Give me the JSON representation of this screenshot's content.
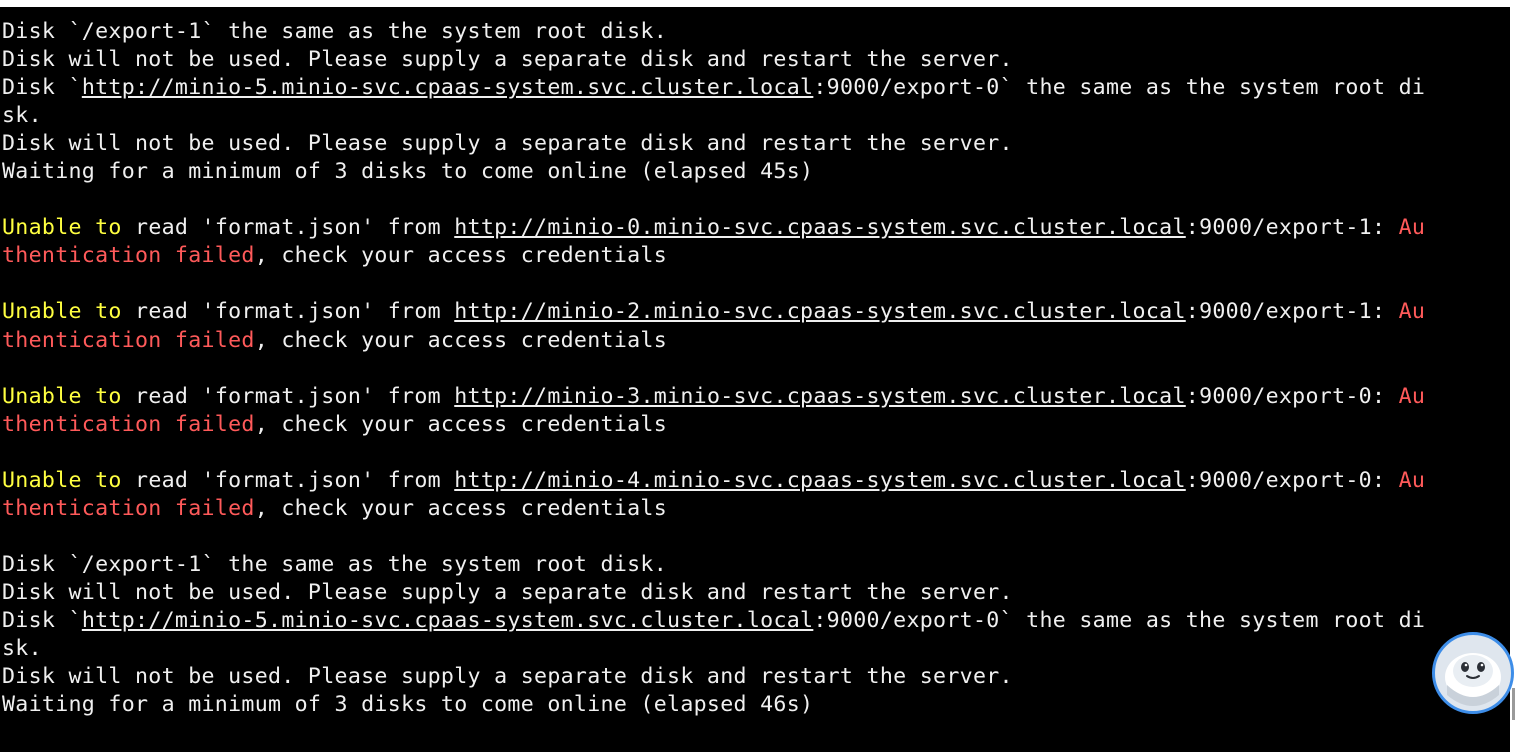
{
  "terminal": {
    "lines": [
      [
        {
          "t": "Disk `/export-1` the same as the system root disk.",
          "c": "w"
        }
      ],
      [
        {
          "t": "Disk will not be used. Please supply a separate disk and restart the server.",
          "c": "w"
        }
      ],
      [
        {
          "t": "Disk `",
          "c": "w"
        },
        {
          "t": "http://minio-5.minio-svc.cpaas-system.svc.cluster.local",
          "c": "w",
          "u": true
        },
        {
          "t": ":9000/export-0` the same as the system root di",
          "c": "w"
        }
      ],
      [
        {
          "t": "sk.",
          "c": "w"
        }
      ],
      [
        {
          "t": "Disk will not be used. Please supply a separate disk and restart the server.",
          "c": "w"
        }
      ],
      [
        {
          "t": "Waiting for a minimum of 3 disks to come online (elapsed 45s)",
          "c": "w"
        }
      ],
      [
        {
          "t": "",
          "c": "w"
        }
      ],
      [
        {
          "t": "Unable to",
          "c": "y"
        },
        {
          "t": " read 'format.json' from ",
          "c": "w"
        },
        {
          "t": "http://minio-0.minio-svc.cpaas-system.svc.cluster.local",
          "c": "w",
          "u": true
        },
        {
          "t": ":9000/export-1: ",
          "c": "w"
        },
        {
          "t": "Au",
          "c": "r"
        }
      ],
      [
        {
          "t": "thentication failed",
          "c": "r"
        },
        {
          "t": ", check your access credentials",
          "c": "w"
        }
      ],
      [
        {
          "t": "",
          "c": "w"
        }
      ],
      [
        {
          "t": "Unable to",
          "c": "y"
        },
        {
          "t": " read 'format.json' from ",
          "c": "w"
        },
        {
          "t": "http://minio-2.minio-svc.cpaas-system.svc.cluster.local",
          "c": "w",
          "u": true
        },
        {
          "t": ":9000/export-1: ",
          "c": "w"
        },
        {
          "t": "Au",
          "c": "r"
        }
      ],
      [
        {
          "t": "thentication failed",
          "c": "r"
        },
        {
          "t": ", check your access credentials",
          "c": "w"
        }
      ],
      [
        {
          "t": "",
          "c": "w"
        }
      ],
      [
        {
          "t": "Unable to",
          "c": "y"
        },
        {
          "t": " read 'format.json' from ",
          "c": "w"
        },
        {
          "t": "http://minio-3.minio-svc.cpaas-system.svc.cluster.local",
          "c": "w",
          "u": true
        },
        {
          "t": ":9000/export-0: ",
          "c": "w"
        },
        {
          "t": "Au",
          "c": "r"
        }
      ],
      [
        {
          "t": "thentication failed",
          "c": "r"
        },
        {
          "t": ", check your access credentials",
          "c": "w"
        }
      ],
      [
        {
          "t": "",
          "c": "w"
        }
      ],
      [
        {
          "t": "Unable to",
          "c": "y"
        },
        {
          "t": " read 'format.json' from ",
          "c": "w"
        },
        {
          "t": "http://minio-4.minio-svc.cpaas-system.svc.cluster.local",
          "c": "w",
          "u": true
        },
        {
          "t": ":9000/export-0: ",
          "c": "w"
        },
        {
          "t": "Au",
          "c": "r"
        }
      ],
      [
        {
          "t": "thentication failed",
          "c": "r"
        },
        {
          "t": ", check your access credentials",
          "c": "w"
        }
      ],
      [
        {
          "t": "",
          "c": "w"
        }
      ],
      [
        {
          "t": "Disk `/export-1` the same as the system root disk.",
          "c": "w"
        }
      ],
      [
        {
          "t": "Disk will not be used. Please supply a separate disk and restart the server.",
          "c": "w"
        }
      ],
      [
        {
          "t": "Disk `",
          "c": "w"
        },
        {
          "t": "http://minio-5.minio-svc.cpaas-system.svc.cluster.local",
          "c": "w",
          "u": true
        },
        {
          "t": ":9000/export-0` the same as the system root di",
          "c": "w"
        }
      ],
      [
        {
          "t": "sk.",
          "c": "w"
        }
      ],
      [
        {
          "t": "Disk will not be used. Please supply a separate disk and restart the server.",
          "c": "w"
        }
      ],
      [
        {
          "t": "Waiting for a minimum of 3 disks to come online (elapsed 46s)",
          "c": "w"
        }
      ]
    ]
  },
  "colors": {
    "background": "#000000",
    "text": "#f0f0f0",
    "warning_yellow": "#ffff40",
    "error_red": "#ff5a5a",
    "bubble_border": "#3d8de8"
  },
  "icons": {
    "assistant_bubble": "robot-face-icon"
  }
}
